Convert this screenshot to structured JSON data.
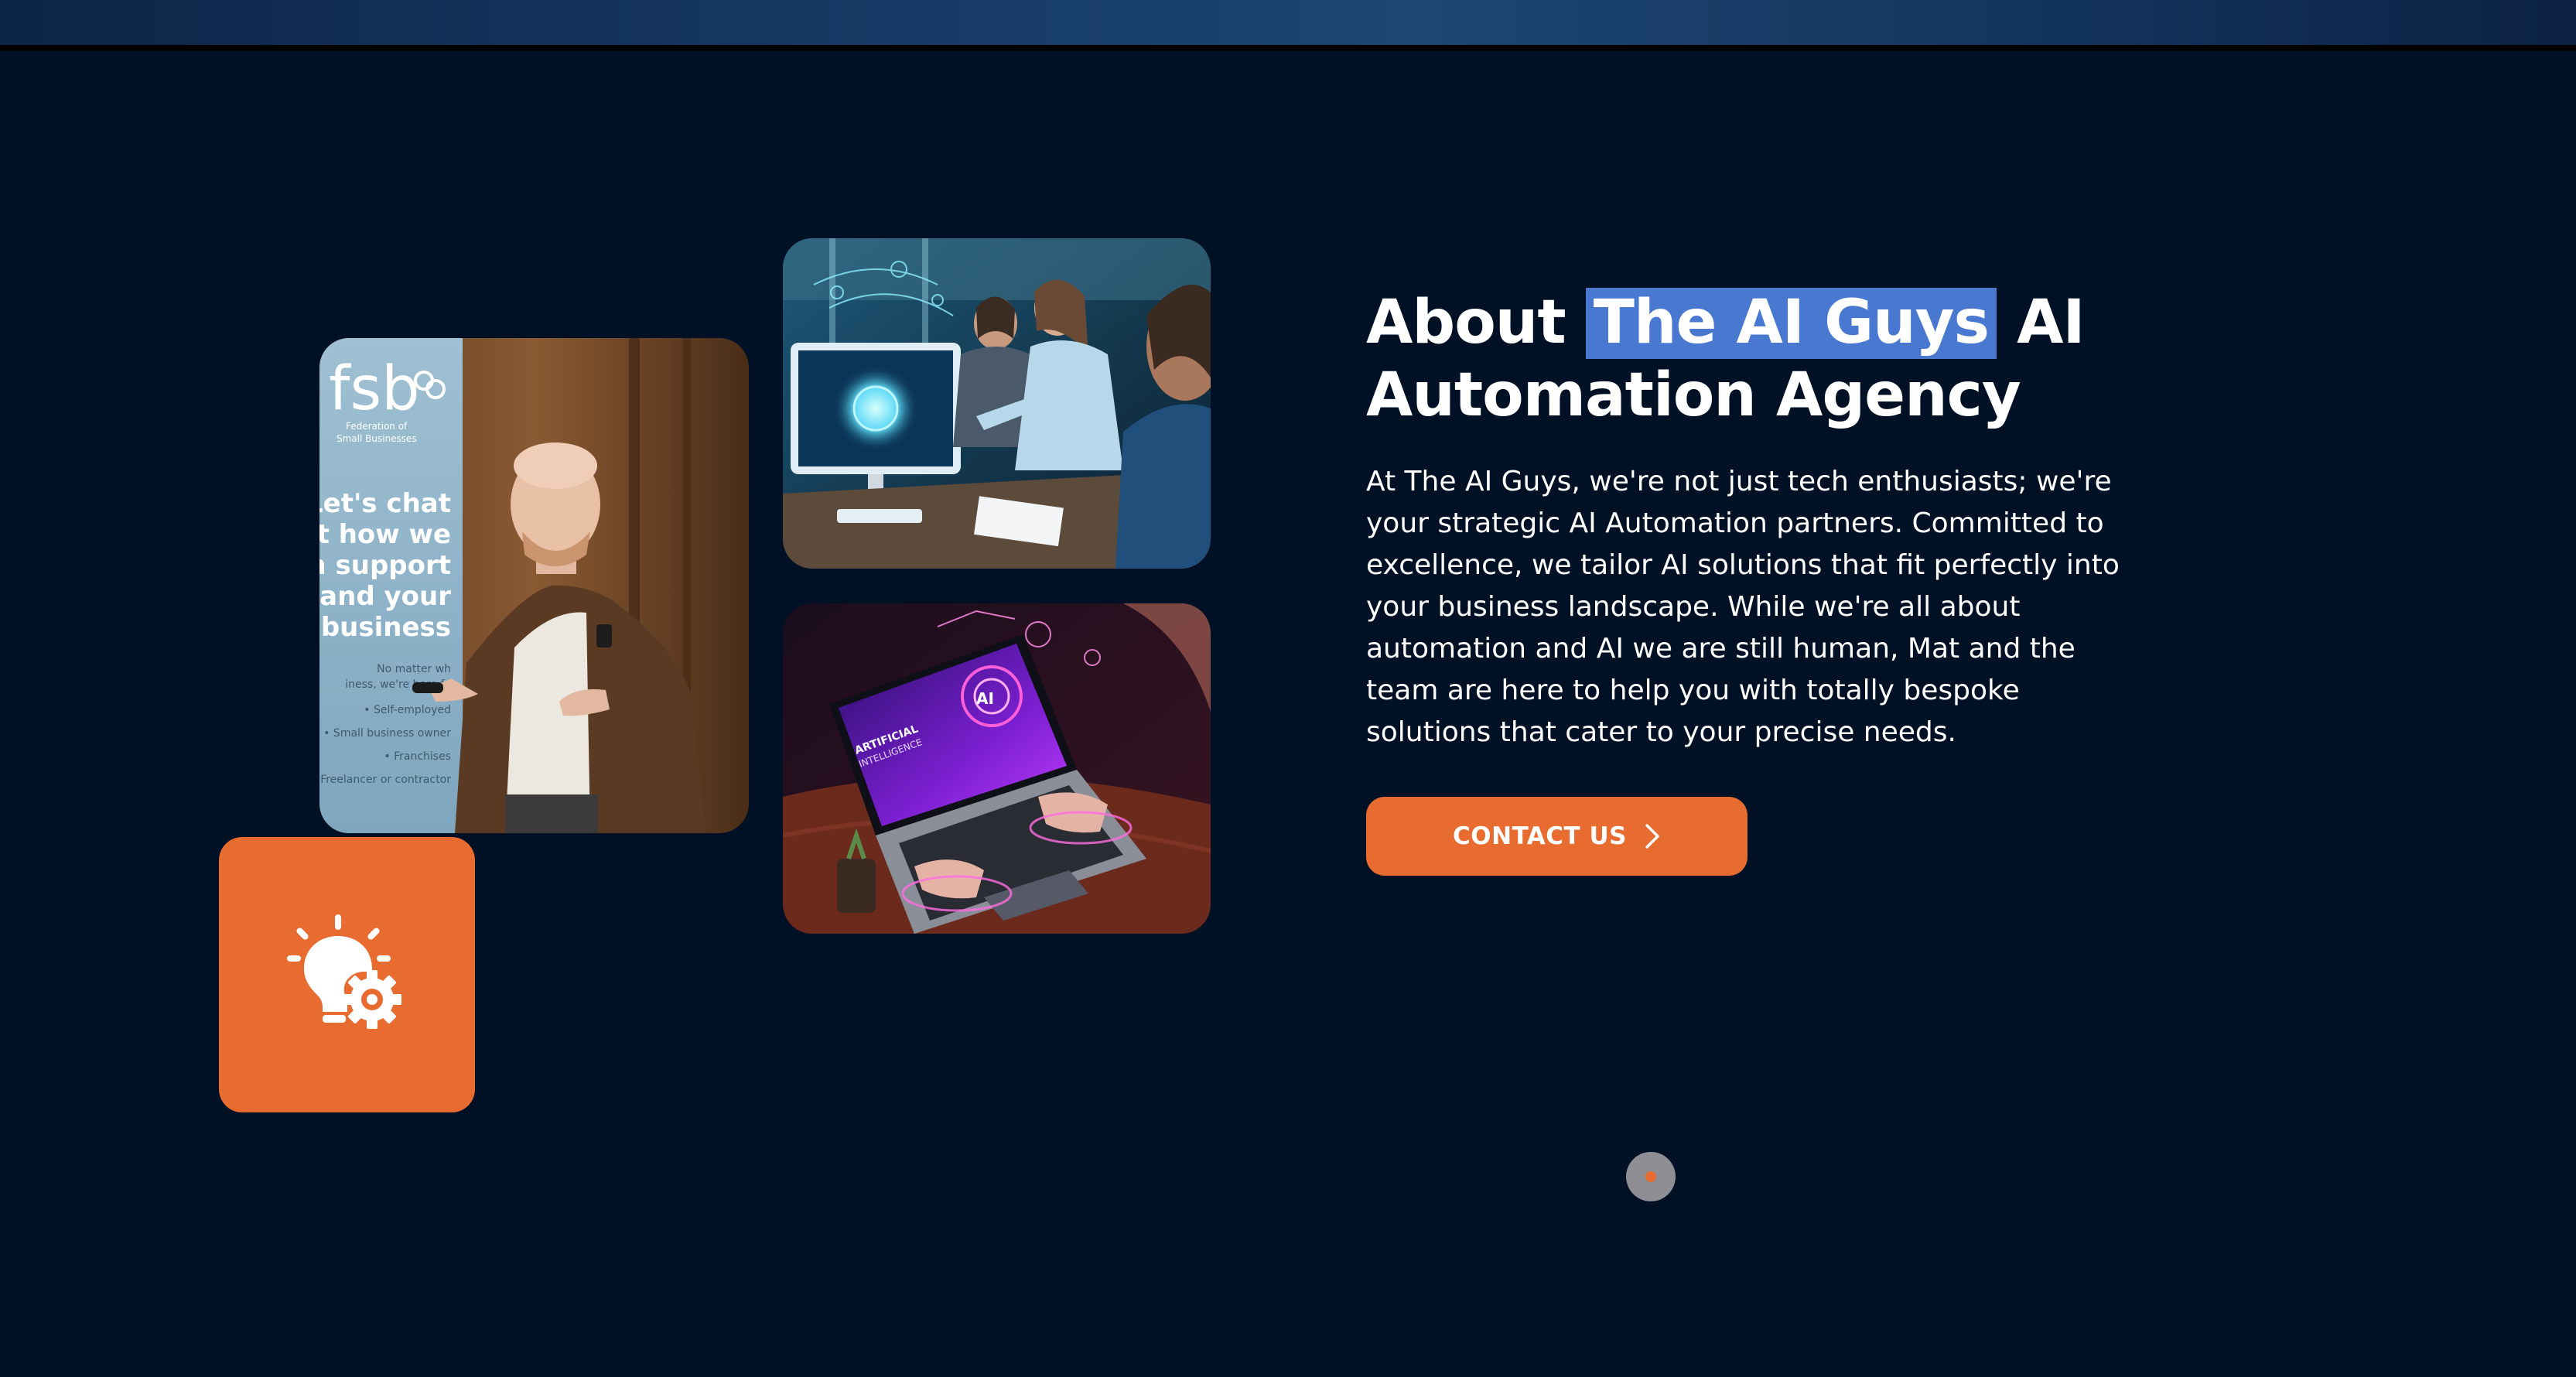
{
  "about": {
    "heading_before": "About ",
    "heading_highlight": "The AI Guys",
    "heading_after": " AI Automation Agency",
    "paragraph": "At The AI Guys, we're not just tech enthusiasts; we're your strategic AI Automation partners. Committed to excellence, we tailor AI solutions that fit perfectly into your business landscape. While we're all about automation and AI we are still human, Mat and the team are here to help you with totally bespoke solutions that cater to your precise needs.",
    "contact_label": "CONTACT US"
  },
  "photo_speaker": {
    "logo": "fsb",
    "logo_sub1": "Federation of",
    "logo_sub2": "Small Businesses",
    "banner_lines": [
      "Let's chat",
      "ut how we",
      "an support",
      "u and your",
      "business"
    ],
    "list_lines": [
      "No matter wh",
      "iness, we're here fo",
      "• Self-employed",
      "• Small business owner",
      "• Franchises",
      "• Freelancer or contractor"
    ]
  },
  "photo_laptop": {
    "screen_line1": "ARTIFICIAL",
    "screen_line2": "INTELLIGENCE",
    "chip": "AI"
  },
  "icons": {
    "badge": "lightbulb-gear-icon",
    "contact_arrow": "chevron-right-icon",
    "scroll": "scroll-to-top-icon"
  },
  "colors": {
    "background": "#001126",
    "accent": "#e86c2f",
    "highlight": "#4878d0"
  }
}
